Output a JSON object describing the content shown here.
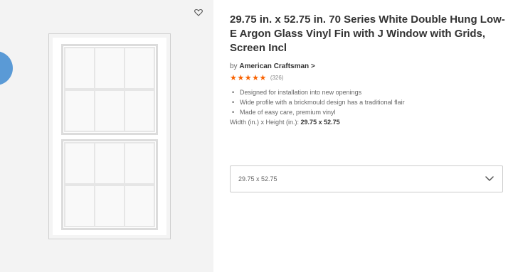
{
  "product": {
    "title": "29.75 in. x 52.75 in. 70 Series White Double Hung Low-E Argon Glass Vinyl Fin with J Window with Grids, Screen Incl",
    "by_prefix": "by",
    "brand": "American Craftsman",
    "brand_chevron": ">",
    "stars": "★★★★★",
    "review_count": "(326)",
    "bullets": [
      "Designed for installation into new openings",
      "Wide profile with a brickmould design has a traditional flair",
      "Made of easy care, premium vinyl"
    ],
    "size_label": "Width (in.) x Height (in.):",
    "size_value": "29.75 x 52.75",
    "dropdown_value": "29.75 x 52.75"
  },
  "icons": {
    "favorite": "heart-icon",
    "dropdown": "chevron-down-icon"
  },
  "colors": {
    "star": "#f96302",
    "title": "#333333",
    "muted": "#666666"
  }
}
